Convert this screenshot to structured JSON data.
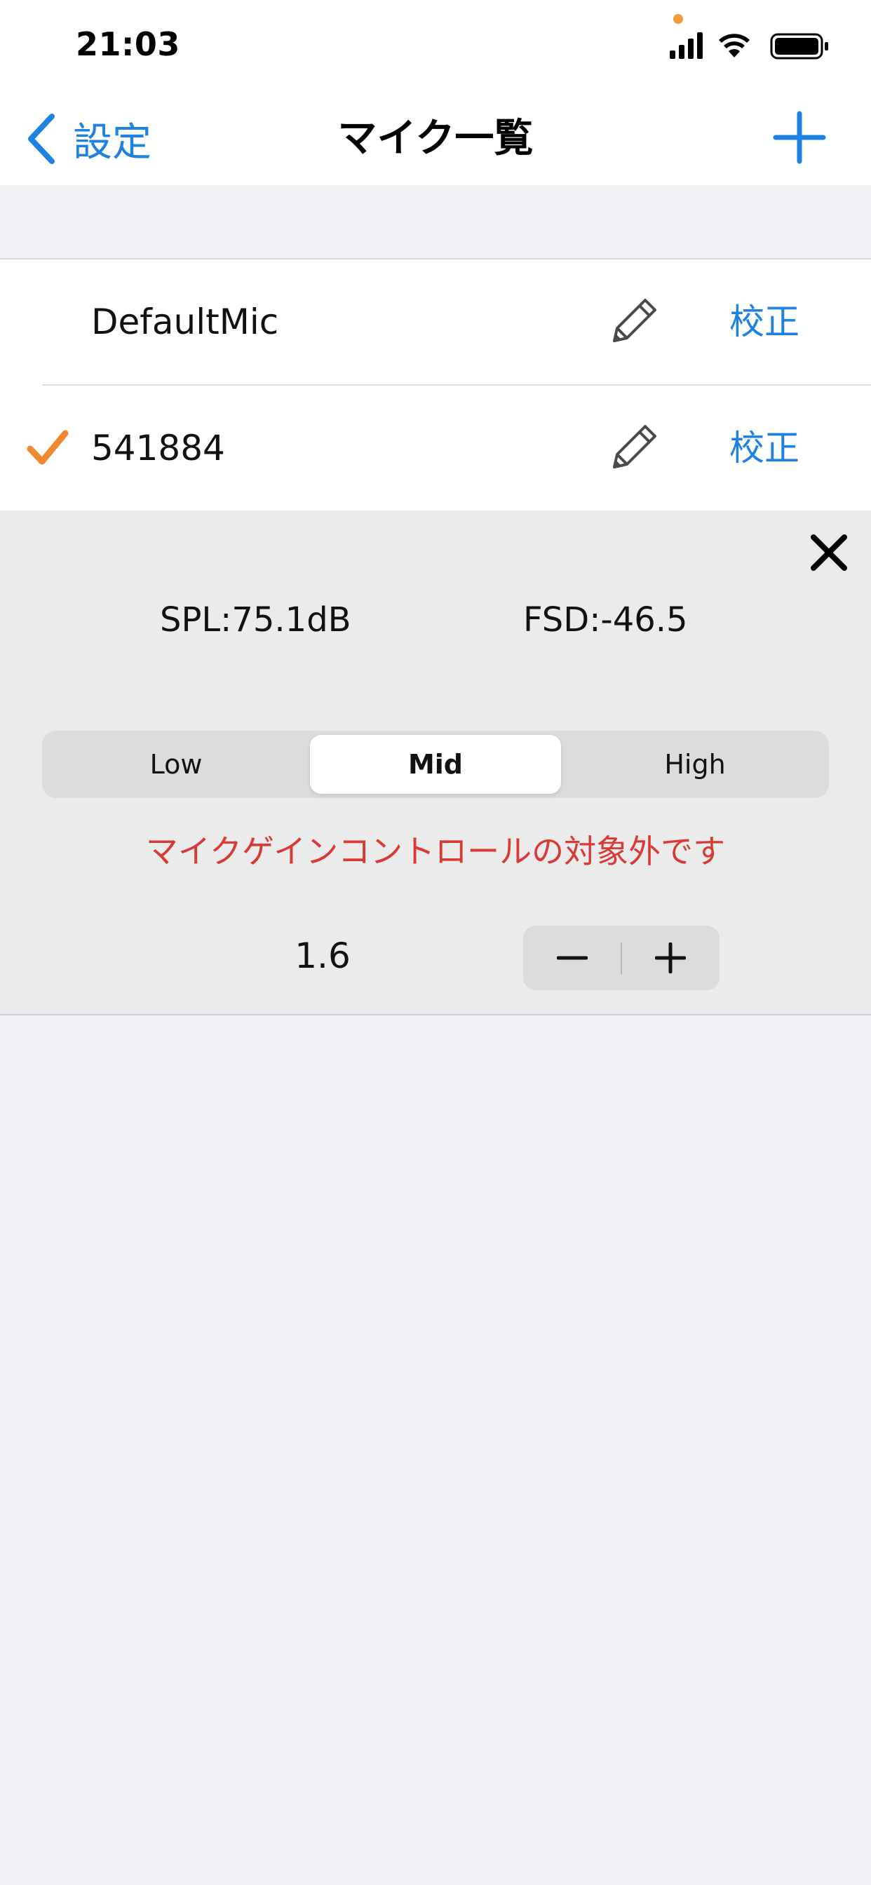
{
  "status_bar": {
    "time": "21:03",
    "icons": [
      "cellular-signal-icon",
      "wifi-icon",
      "battery-icon"
    ],
    "privacy_dot_color": "#f39a3c"
  },
  "nav": {
    "back_label": "設定",
    "title": "マイク一覧",
    "add_icon": "plus-icon"
  },
  "colors": {
    "accent": "#1e82e2",
    "check": "#f0892e",
    "warning": "#d93a35"
  },
  "mics": [
    {
      "name": "DefaultMic",
      "selected": false,
      "calibrate_label": "校正"
    },
    {
      "name": "541884",
      "selected": true,
      "calibrate_label": "校正"
    }
  ],
  "detail": {
    "spl": "SPL:75.1dB",
    "fsd": "FSD:-46.5",
    "gain_options": [
      "Low",
      "Mid",
      "High"
    ],
    "gain_selected": "Mid",
    "warning": "マイクゲインコントロールの対象外です",
    "stepper_value": "1.6"
  }
}
